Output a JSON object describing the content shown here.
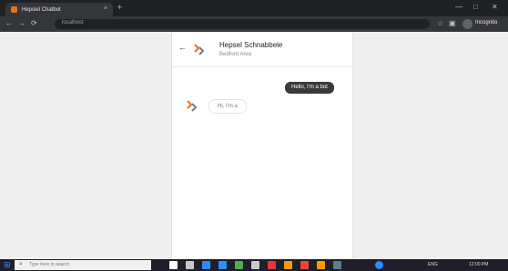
{
  "browser": {
    "tab_title": "Hepsiel Chatbot",
    "new_tab": "+",
    "tab_close": "×",
    "window_minimize": "—",
    "window_maximize": "□",
    "window_close": "✕",
    "url": "localhost",
    "incognito_label": "Incognito",
    "back": "←",
    "forward": "→",
    "reload": "⟳"
  },
  "chat": {
    "back_icon": "←",
    "title": "Hepsel Schnabbele",
    "subtitle": "Bedford Area",
    "messages": [
      {
        "sender": "user",
        "text": "Hello, I'm a bot"
      },
      {
        "sender": "bot",
        "text": "Hi, I'm a"
      }
    ]
  },
  "taskbar": {
    "search_placeholder": "Type here to search",
    "time": "12:00 PM",
    "tray_label": "ENG"
  },
  "colors": {
    "logo_orange": "#e9711c",
    "logo_grey": "#7b7b7b",
    "dark_bubble": "#3a3a3a"
  }
}
